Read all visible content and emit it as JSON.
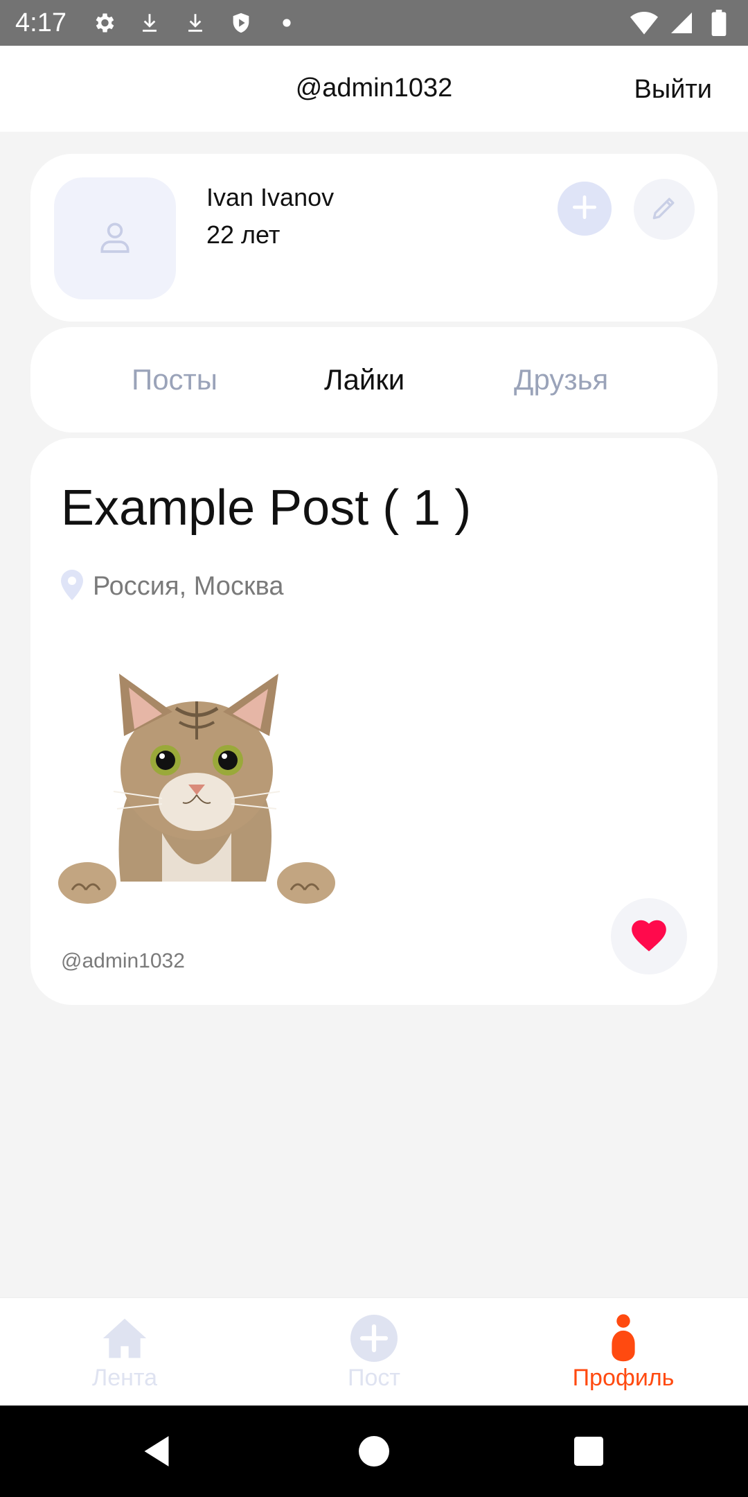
{
  "status_bar": {
    "time": "4:17",
    "left_icons": [
      "gear-icon",
      "download-icon",
      "download-icon",
      "shield-icon",
      "dot-icon"
    ],
    "right_icons": [
      "wifi-icon",
      "signal-icon",
      "battery-icon"
    ]
  },
  "header": {
    "username": "@admin1032",
    "logout_label": "Выйти"
  },
  "profile": {
    "name": "Ivan Ivanov",
    "age": "22 лет"
  },
  "tabs": {
    "posts_label": "Посты",
    "likes_label": "Лайки",
    "friends_label": "Друзья",
    "active": "likes"
  },
  "post": {
    "title": "Example Post ( 1 )",
    "location": "Россия, Москва",
    "author": "@admin1032",
    "liked": true
  },
  "bottom_nav": {
    "feed_label": "Лента",
    "post_label": "Пост",
    "profile_label": "Профиль",
    "active": "profile"
  },
  "colors": {
    "accent": "#ff4a10",
    "like": "#ff0a4c",
    "muted_blue": "#9aa3b9",
    "icon_bg": "#dfe4f7"
  }
}
